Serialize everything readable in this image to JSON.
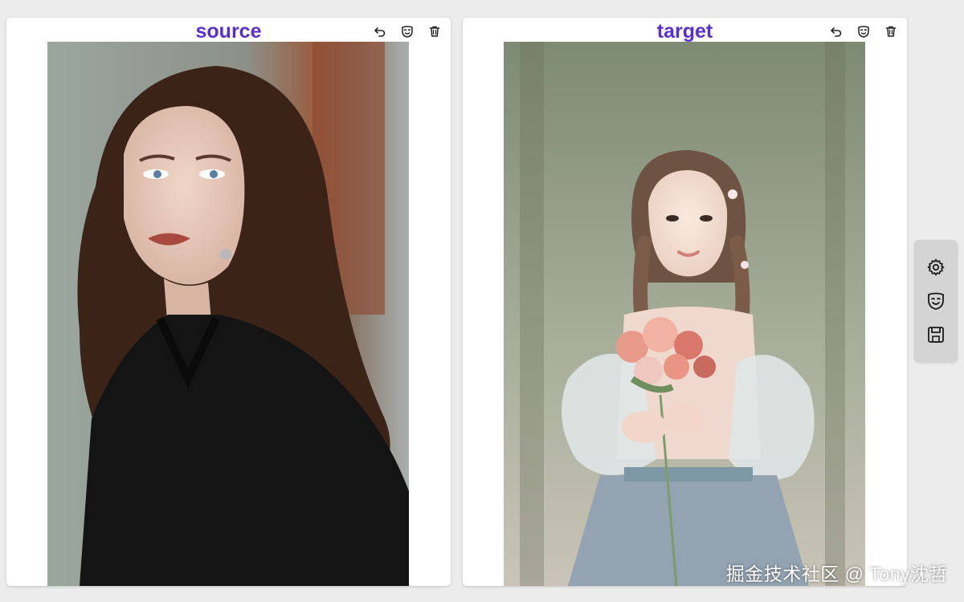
{
  "panels": {
    "source": {
      "title": "source"
    },
    "target": {
      "title": "target"
    }
  },
  "panel_tools": [
    "undo-icon",
    "face-mask-icon",
    "trash-icon"
  ],
  "side_toolbar": [
    "gear-icon",
    "theater-mask-icon",
    "save-icon"
  ],
  "watermark": "掘金技术社区 @ Tony沈哲",
  "colors": {
    "title": "#5a2fd0",
    "panel_bg": "#ffffff",
    "page_bg": "#ececec",
    "toolbar_bg": "#d4d4d4"
  }
}
